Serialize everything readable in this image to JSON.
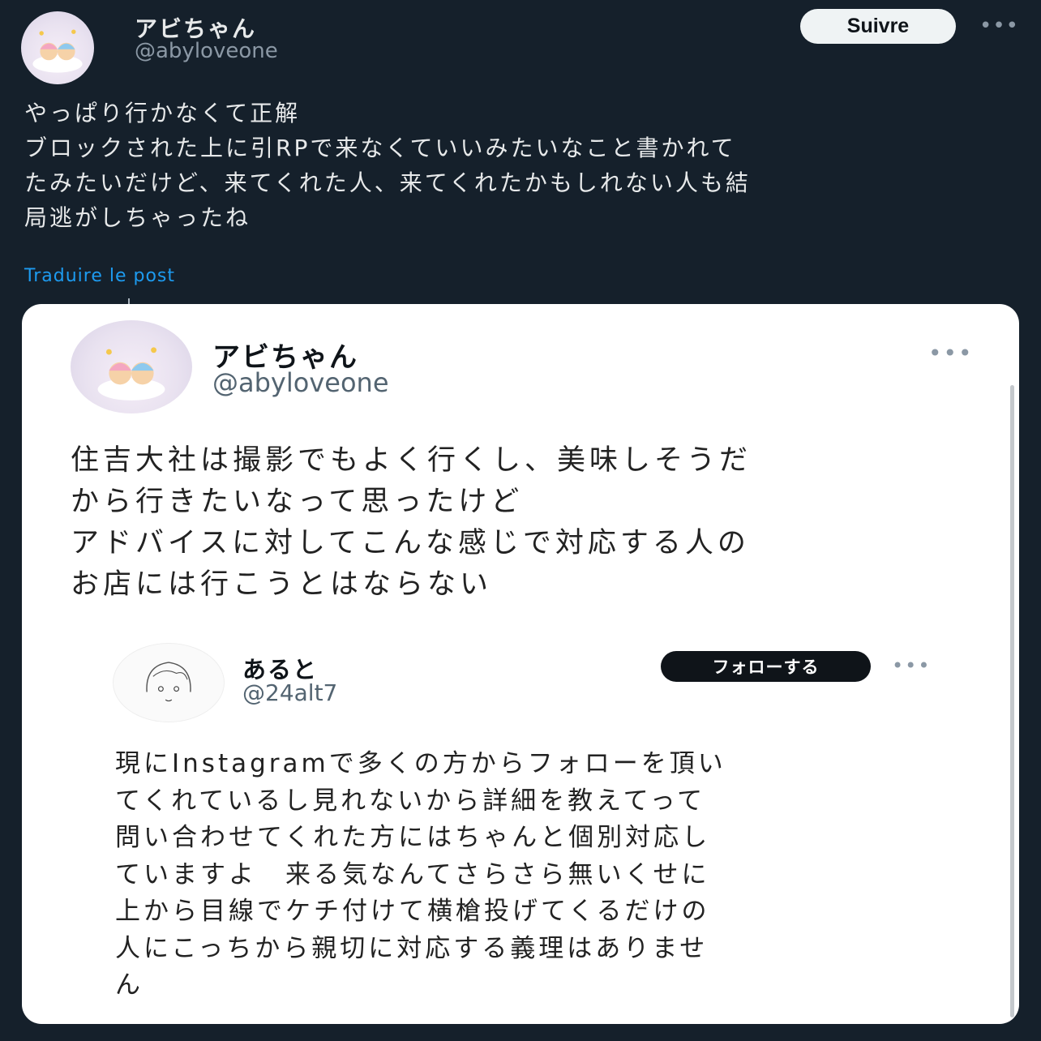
{
  "post": {
    "author_name": "アビちゃん",
    "author_handle": "@abyloveone",
    "follow_label": "Suivre",
    "more_label": "•••",
    "text_lines": [
      "やっぱり行かなくて正解",
      "ブロックされた上に引RPで来なくていいみたいなこと書かれて",
      "たみたいだけど、来てくれた人、来てくれたかもしれない人も結",
      "局逃がしちゃったね"
    ],
    "translate_label": "Traduire le post"
  },
  "quoted": {
    "author_name": "アビちゃん",
    "author_handle": "@abyloveone",
    "more_label": "•••",
    "text_lines": [
      "住吉大社は撮影でもよく行くし、美味しそうだ",
      "から行きたいなって思ったけど",
      "アドバイスに対してこんな感じで対応する人の",
      "お店には行こうとはならない"
    ]
  },
  "reply": {
    "author_name": "あると",
    "author_handle": "@24alt7",
    "follow_label": "フォローする",
    "more_label": "•••",
    "text_lines": [
      "現にInstagramで多くの方からフォローを頂い",
      "てくれているし見れないから詳細を教えてって",
      "問い合わせてくれた方にはちゃんと個別対応し",
      "ていますよ　来る気なんてさらさら無いくせに",
      "上から目線でケチ付けて横槍投げてくるだけの",
      "人にこっちから親切に対応する義理はありませ",
      "ん"
    ]
  },
  "colors": {
    "background": "#15202b",
    "text": "#e7e9ea",
    "secondary_text": "#8b98a5",
    "link": "#1d9bf0",
    "card_background": "#ffffff"
  }
}
